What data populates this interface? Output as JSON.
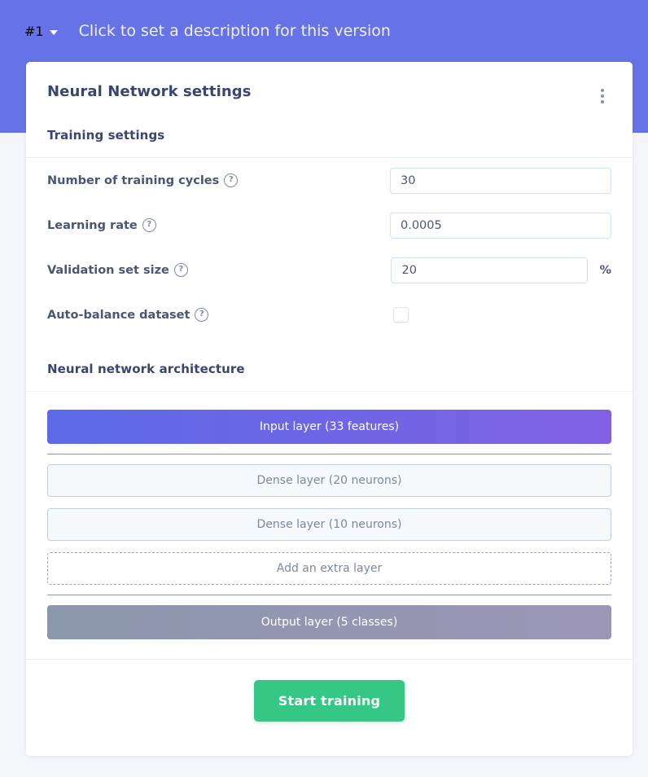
{
  "header": {
    "version_label": "#1",
    "caret_icon": "chevron-down-icon",
    "description_placeholder": "Click to set a description for this version",
    "band_color": "#6573e6"
  },
  "card": {
    "title": "Neural Network settings",
    "menu_icon": "kebab-menu-icon"
  },
  "training": {
    "section_title": "Training settings",
    "fields": [
      {
        "label": "Number of training cycles",
        "help_icon": "help-circle-icon",
        "value": "30",
        "unit": ""
      },
      {
        "label": "Learning rate",
        "help_icon": "help-circle-icon",
        "value": "0.0005",
        "unit": ""
      },
      {
        "label": "Validation set size",
        "help_icon": "help-circle-icon",
        "value": "20",
        "unit": "%"
      },
      {
        "label": "Auto-balance dataset",
        "help_icon": "help-circle-icon",
        "value": "",
        "unit": "",
        "checked": false
      }
    ]
  },
  "architecture": {
    "section_title": "Neural network architecture",
    "input_layer": {
      "label": "Input layer (33 features)",
      "gradient_from": "#5c6ae8",
      "gradient_to": "#8061e3"
    },
    "hidden_layers": [
      {
        "label": "Dense layer (20 neurons)"
      },
      {
        "label": "Dense layer (10 neurons)"
      }
    ],
    "add_layer": {
      "label": "Add an extra layer"
    },
    "output_layer": {
      "label": "Output layer (5 classes)",
      "gradient_from": "#8b97ad",
      "gradient_to": "#9c96b6"
    }
  },
  "footer": {
    "start_button": "Start training",
    "button_color": "#34c884"
  }
}
